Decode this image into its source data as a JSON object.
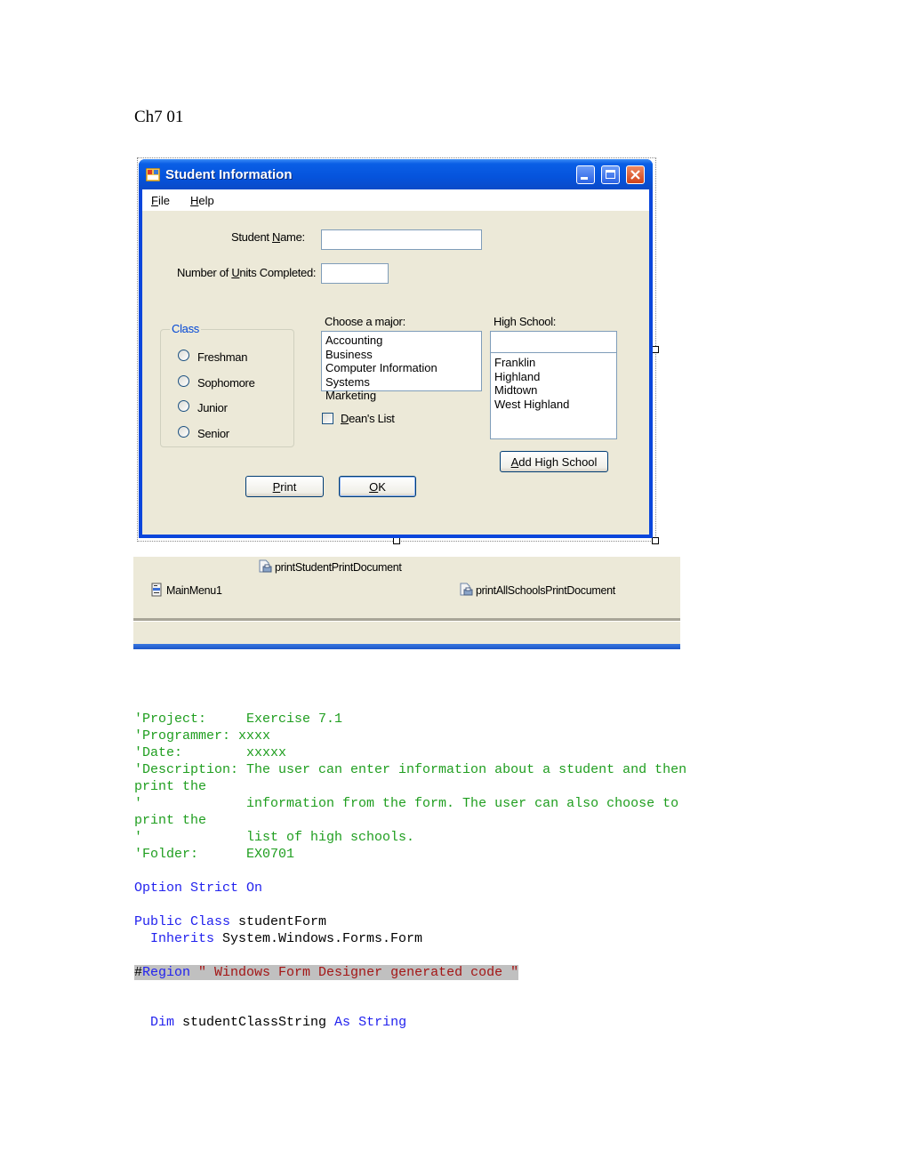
{
  "document": {
    "heading": "Ch7 01"
  },
  "window": {
    "title": "Student Information",
    "menu": [
      {
        "label": "File",
        "mnemonic": "F",
        "rest": "ile"
      },
      {
        "label": "Help",
        "mnemonic": "H",
        "rest": "elp"
      }
    ],
    "controls": {
      "minimize": "minimize",
      "maximize": "maximize",
      "close": "close"
    }
  },
  "form": {
    "student_name_label": {
      "pre": "Student ",
      "mnemonic": "N",
      "post": "ame:"
    },
    "student_name_value": "",
    "units_label": {
      "pre": "Number of ",
      "mnemonic": "U",
      "post": "nits Completed:"
    },
    "units_value": "",
    "class_group": {
      "label": "Class",
      "options": [
        "Freshman",
        "Sophomore",
        "Junior",
        "Senior"
      ],
      "selected": null
    },
    "major": {
      "label": "Choose a major:",
      "items": [
        "Accounting",
        "Business",
        "Computer Information Systems",
        "Marketing"
      ]
    },
    "deans_list": {
      "mnemonic": "D",
      "rest": "ean's List",
      "checked": false
    },
    "high_school": {
      "label": "High School:",
      "input_value": "",
      "items": [
        "Franklin",
        "Highland",
        "Midtown",
        "West Highland"
      ]
    },
    "buttons": {
      "add_high_school": {
        "mnemonic": "A",
        "rest": "dd High School"
      },
      "print": {
        "mnemonic": "P",
        "rest": "rint"
      },
      "ok": {
        "mnemonic": "O",
        "rest": "K"
      }
    }
  },
  "component_tray": {
    "items": [
      "printStudentPrintDocument",
      "MainMenu1",
      "printAllSchoolsPrintDocument"
    ]
  },
  "code": {
    "comment_lines": [
      "'Project:     Exercise 7.1",
      "'Programmer: xxxx",
      "'Date:        xxxxx",
      "'Description: The user can enter information about a student and then",
      "print the",
      "'             information from the form. The user can also choose to",
      "print the",
      "'             list of high schools.",
      "'Folder:      EX0701"
    ],
    "option_strict": "Option Strict On",
    "class_decl": {
      "kw": "Public Class",
      "name": " studentForm"
    },
    "inherits": {
      "kw": "  Inherits",
      "name": " System.Windows.Forms.Form"
    },
    "region": {
      "hash": "#",
      "kw": "Region",
      "text": " \" Windows Form Designer generated code \""
    },
    "dim": {
      "kw1": "  Dim",
      "name": " studentClassString ",
      "kw2": "As",
      "sp": " ",
      "type": "String"
    }
  }
}
